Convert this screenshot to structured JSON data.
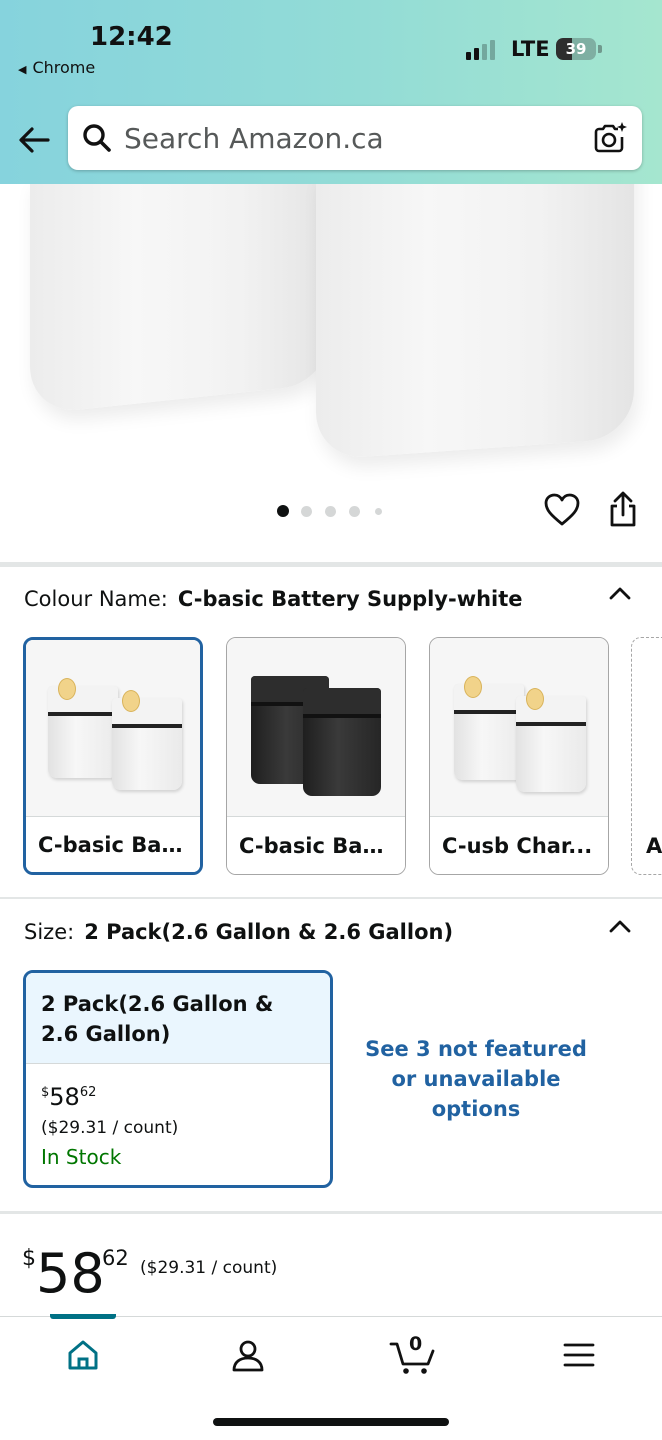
{
  "status_bar": {
    "time": "12:42",
    "back_app": "Chrome",
    "network": "LTE",
    "battery": "39"
  },
  "header": {
    "search_placeholder": "Search Amazon.ca"
  },
  "image_carousel": {
    "dot_count": 5,
    "active_index": 0
  },
  "colour": {
    "label": "Colour Name:",
    "value": "C-basic Battery Supply-white",
    "options": [
      {
        "label": "C-basic Bat...",
        "color": "white",
        "selected": true
      },
      {
        "label": "C-basic Bat...",
        "color": "black",
        "selected": false
      },
      {
        "label": "C-usb Char...",
        "color": "white",
        "selected": false
      },
      {
        "label": "A",
        "partial": true
      }
    ]
  },
  "size": {
    "label": "Size:",
    "value": "2 Pack(2.6 Gallon & 2.6 Gallon)",
    "card": {
      "title": "2 Pack(2.6 Gallon & 2.6 Gallon)",
      "price_symbol": "$",
      "price_whole": "58",
      "price_fraction": "62",
      "unit_price": "($29.31 / count)",
      "availability": "In Stock"
    },
    "see_more": "See 3 not featured or unavailable options"
  },
  "price": {
    "symbol": "$",
    "whole": "58",
    "fraction": "62",
    "unit_price": "($29.31 / count)"
  },
  "bottom_nav": {
    "items": [
      "home-icon",
      "account-icon",
      "cart-icon",
      "menu-icon"
    ],
    "cart_count": "0",
    "active": "home"
  },
  "colors": {
    "accent_blue": "#2162a1",
    "in_stock_green": "#007600",
    "nav_active": "#007185"
  }
}
